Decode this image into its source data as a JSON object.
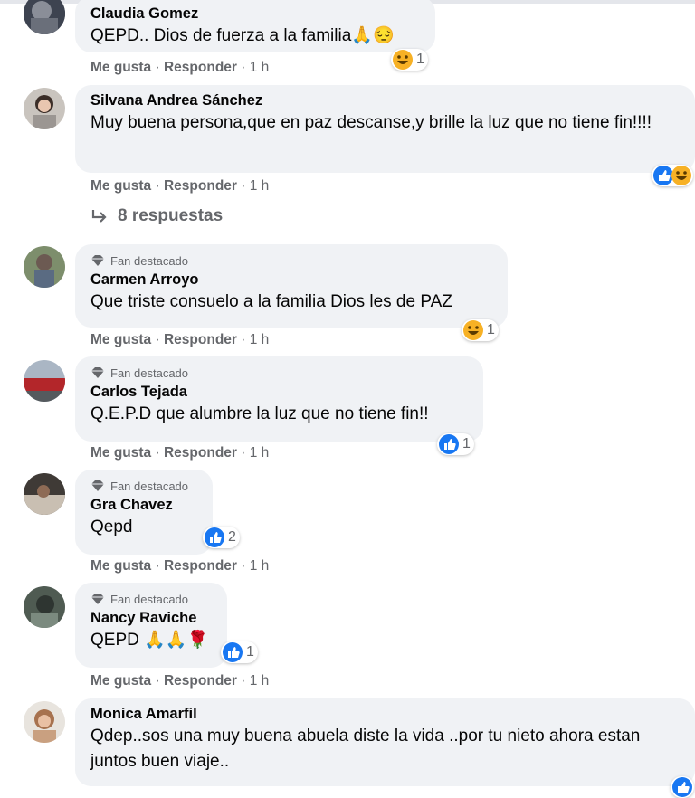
{
  "comments": [
    {
      "name": "Claudia Gomez",
      "text": "QEPD.. Dios de fuerza a la familia🙏😔",
      "fan": "",
      "time": "1 h",
      "reaction_count": "1",
      "reactions": [
        "haha"
      ]
    },
    {
      "name": "Silvana Andrea Sánchez",
      "text": "Muy buena persona,que en paz descanse,y brille la luz que no tiene fin!!!!",
      "fan": "",
      "time": "1 h",
      "reaction_count": "",
      "reactions": [
        "like",
        "haha"
      ]
    },
    {
      "name": "Carmen Arroyo",
      "text": "Que triste consuelo a la familia Dios les de PAZ",
      "fan": "Fan destacado",
      "time": "1 h",
      "reaction_count": "1",
      "reactions": [
        "haha"
      ]
    },
    {
      "name": "Carlos Tejada",
      "text": "Q.E.P.D que alumbre la luz que no tiene fin!!",
      "fan": "Fan destacado",
      "time": "1 h",
      "reaction_count": "1",
      "reactions": [
        "like"
      ]
    },
    {
      "name": "Gra Chavez",
      "text": "Qepd",
      "fan": "Fan destacado",
      "time": "1 h",
      "reaction_count": "2",
      "reactions": [
        "like"
      ]
    },
    {
      "name": "Nancy Raviche",
      "text": "QEPD 🙏🙏🌹",
      "fan": "Fan destacado",
      "time": "1 h",
      "reaction_count": "1",
      "reactions": [
        "like"
      ]
    },
    {
      "name": "Monica Amarfil",
      "text": "Qdep..sos una muy buena abuela diste la vida ..por tu nieto ahora estan juntos buen viaje..",
      "fan": "",
      "time": "",
      "reaction_count": "",
      "reactions": [
        "like"
      ]
    }
  ],
  "actions": {
    "like": "Me gusta",
    "reply": "Responder",
    "separator": "·"
  },
  "replies_label": "8 respuestas",
  "colors": {
    "bubble": "#f0f2f5",
    "meta": "#65676b",
    "like": "#1877f2",
    "haha": "#f7b125"
  }
}
